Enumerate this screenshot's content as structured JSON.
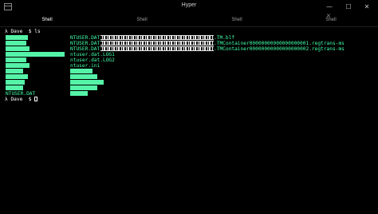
{
  "window": {
    "title": "Hyper",
    "controls": {
      "minimize": "—",
      "maximize": "☐",
      "close": "✕"
    }
  },
  "tabs": [
    {
      "label": "Shell",
      "active": true
    },
    {
      "label": "Shell",
      "active": false
    },
    {
      "label": "Shell",
      "active": false
    },
    {
      "label": "Shell",
      "active": false
    }
  ],
  "tab_close_glyph": "✕",
  "terminal": {
    "prompt1": "λ Dave  $ ls",
    "files": [
      "NTUSER.DAT",
      ".TM.blf",
      "NTUSER.DAT",
      ".TMContainer00000000000000000001.regtrans-ms",
      "NTUSER.DAT",
      ".TMContainer00000000000000000002.regtrans-ms",
      "ntuser.dat.LOG1",
      "ntuser.dat.LOG2",
      "ntuser.ini"
    ],
    "last_file": "NTUSER.DAT",
    "prompt2": "λ Dave  $ "
  },
  "colors": {
    "background": "#000000",
    "highlight": "#55f3a8",
    "directory_text": "#40ffa8",
    "prompt_text": "#ffffff"
  }
}
